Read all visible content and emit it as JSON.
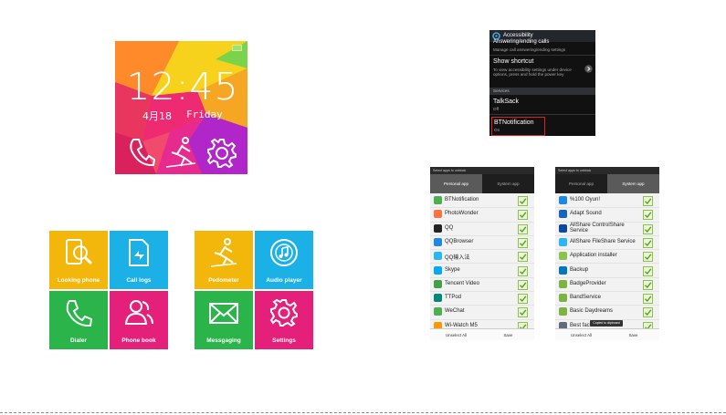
{
  "watch": {
    "time": "12:45",
    "date": "4月18",
    "day": "Friday",
    "icons": [
      "phone-icon",
      "pedometer-icon",
      "settings-icon"
    ]
  },
  "menu_left": {
    "tiles": [
      {
        "label": "Looking phone",
        "color": "#f2b70a",
        "icon": "looking-phone-icon"
      },
      {
        "label": "Call logs",
        "color": "#1bb0e6",
        "icon": "call-logs-icon"
      },
      {
        "label": "Dialer",
        "color": "#2ab44a",
        "icon": "dialer-icon"
      },
      {
        "label": "Phone book",
        "color": "#e5207a",
        "icon": "phone-book-icon"
      }
    ]
  },
  "menu_right": {
    "tiles": [
      {
        "label": "Pedometer",
        "color": "#f2b70a",
        "icon": "pedometer-icon"
      },
      {
        "label": "Audio player",
        "color": "#1bb0e6",
        "icon": "audio-player-icon"
      },
      {
        "label": "Messgaging",
        "color": "#2ab44a",
        "icon": "messaging-icon"
      },
      {
        "label": "Settings",
        "color": "#e5207a",
        "icon": "settings-icon"
      }
    ]
  },
  "accessibility": {
    "title": "Accessibility",
    "items": [
      {
        "title": "Answering/ending calls",
        "sub": "Manage call answering/ending settings"
      },
      {
        "title": "Show shortcut",
        "sub": "To view accessibility settings under device options, press and hold the power key"
      }
    ],
    "section": "Services",
    "services": [
      {
        "title": "TalkSack",
        "sub": "Off"
      },
      {
        "title": "BTNotification",
        "sub": "On"
      }
    ],
    "highlight_color": "#e02020"
  },
  "personal_list": {
    "header": "Select apps to unblock",
    "tabs": [
      "Personal app",
      "System app"
    ],
    "active_tab": "Personal app",
    "apps": [
      {
        "name": "BTNotification",
        "color": "#4caf50"
      },
      {
        "name": "PhotoWonder",
        "color": "#ff7043"
      },
      {
        "name": "QQ",
        "color": "#222222"
      },
      {
        "name": "QQBrowser",
        "color": "#1e88e5"
      },
      {
        "name": "QQ输入法",
        "color": "#29b6f6"
      },
      {
        "name": "Skype",
        "color": "#03a9f4"
      },
      {
        "name": "Tencent Video",
        "color": "#43a047"
      },
      {
        "name": "TTPod",
        "color": "#00897b"
      },
      {
        "name": "WeChat",
        "color": "#4caf50"
      },
      {
        "name": "Wi-Watch M5",
        "color": "#ff9800"
      }
    ],
    "buttons": [
      "Unselect All",
      "Save"
    ]
  },
  "system_list": {
    "header": "Select apps to unblock",
    "tabs": [
      "Personal app",
      "System app"
    ],
    "active_tab": "System app",
    "apps": [
      {
        "name": "%100 Oyun!",
        "color": "#1e88e5"
      },
      {
        "name": "Adapt Sound",
        "color": "#1565c0"
      },
      {
        "name": "AllShare ControlShare\nService",
        "color": "#0d47a1"
      },
      {
        "name": "AllShare FileShare Service",
        "color": "#29b6f6"
      },
      {
        "name": "Application installer",
        "color": "#8bc34a"
      },
      {
        "name": "Backup",
        "color": "#0277bd"
      },
      {
        "name": "BadgeProvider",
        "color": "#7cb342"
      },
      {
        "name": "BandService",
        "color": "#7cb342"
      },
      {
        "name": "Basic Daydreams",
        "color": "#7cb342"
      },
      {
        "name": "Best face",
        "color": "#5e6b7a"
      }
    ],
    "toast": "Copied to clipboard",
    "buttons": [
      "Unselect All",
      "Save"
    ]
  }
}
